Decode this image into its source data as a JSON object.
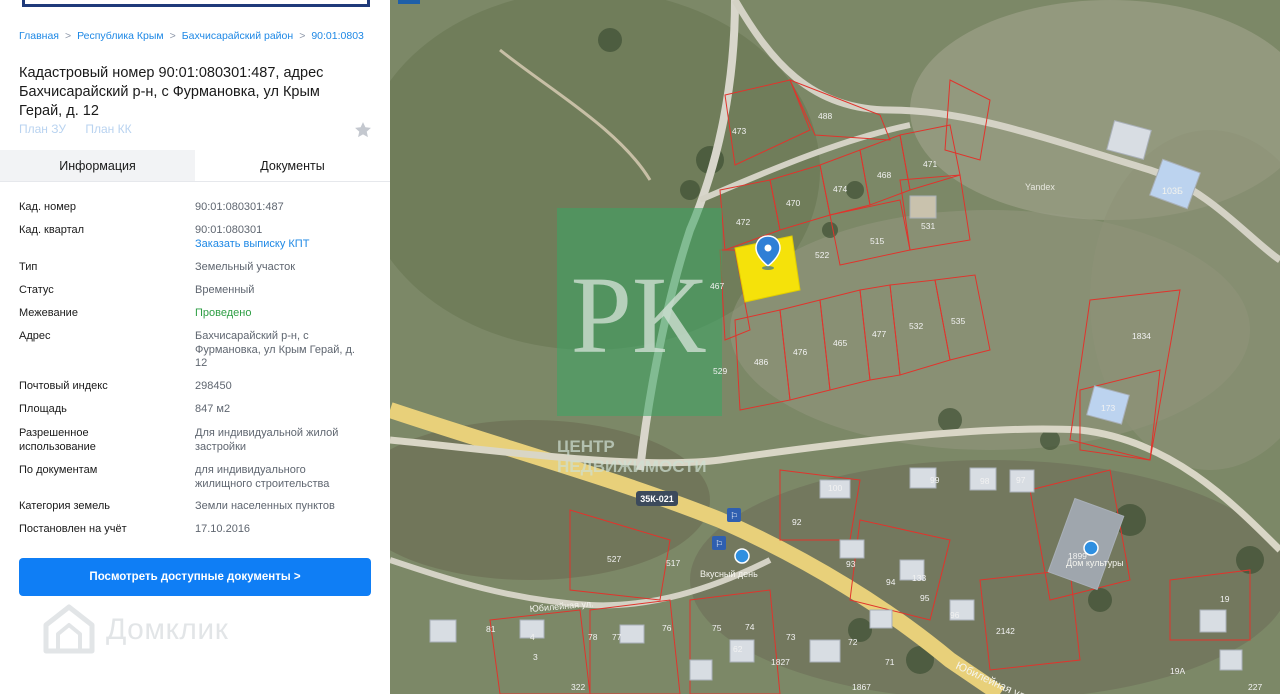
{
  "breadcrumb": {
    "items": [
      "Главная",
      "Республика Крым",
      "Бахчисарайский район",
      "90:01:0803"
    ]
  },
  "title": "Кадастровый номер 90:01:080301:487, адрес Бахчисарайский р-н, с Фурмановка, ул Крым Герай, д. 12",
  "plan_links": {
    "plan_zu": "План ЗУ",
    "plan_kk": "План КК"
  },
  "tabs": {
    "info": "Информация",
    "docs": "Документы"
  },
  "details": [
    {
      "key": "Кад. номер",
      "value": "90:01:080301:487"
    },
    {
      "key": "Кад. квартал",
      "value": "90:01:080301",
      "link": "Заказать выписку КПТ"
    },
    {
      "key": "Тип",
      "value": "Земельный участок"
    },
    {
      "key": "Статус",
      "value": "Временный"
    },
    {
      "key": "Межевание",
      "value": "Проведено"
    },
    {
      "key": "Адрес",
      "value": "Бахчисарайский р-н, с Фурмановка, ул Крым Герай, д. 12"
    },
    {
      "key": "Почтовый индекс",
      "value": "298450"
    },
    {
      "key": "Площадь",
      "value": "847 м2"
    },
    {
      "key": "Разрешенное использование",
      "value": "Для индивидуальной жилой застройки"
    },
    {
      "key": "По документам",
      "value": "для индивидуального жилищного строительства"
    },
    {
      "key": "Категория земель",
      "value": "Земли населенных пунктов"
    },
    {
      "key": "Постановлен на учёт",
      "value": "17.10.2016"
    }
  ],
  "docs_button": "Посмотреть доступные документы >",
  "watermark_brand": "Домклик",
  "map": {
    "agency_logo_letters": "РК",
    "agency_watermark_line1": "ЦЕНТР",
    "agency_watermark_line2": "НЕДВИЖИМОСТИ",
    "road_label": "35К-021",
    "yandex": "Yandex",
    "street_labels": [
      "Юбилейная ул.",
      "Юбилейная ул"
    ],
    "poi_label": "Вкусный день",
    "culture_house": "Дом культуры",
    "building_label": "103Б",
    "parcels": [
      "473",
      "488",
      "471",
      "468",
      "474",
      "470",
      "472",
      "531",
      "515",
      "522",
      "467",
      "535",
      "532",
      "477",
      "465",
      "476",
      "486",
      "529",
      "1834",
      "173",
      "1899",
      "527",
      "517",
      "100",
      "99",
      "98",
      "97",
      "92",
      "93",
      "94",
      "133",
      "95",
      "96",
      "2142",
      "1827",
      "1867",
      "322",
      "78",
      "77",
      "76",
      "75",
      "74",
      "73",
      "72",
      "71",
      "62",
      "81",
      "19",
      "4",
      "3",
      "19А",
      "227"
    ]
  },
  "colors": {
    "accent": "#0f7ef5",
    "link": "#1e88e5",
    "status_green": "#2e9e44",
    "parcel_line": "#e0342c",
    "selected_parcel": "#f5e20a"
  }
}
